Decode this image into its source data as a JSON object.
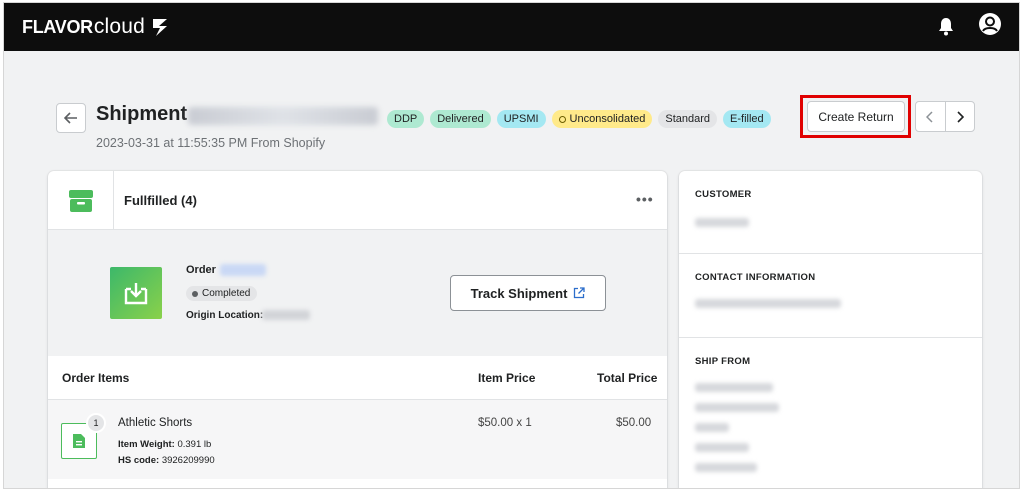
{
  "brand": {
    "bold": "FLAVOR",
    "light": "cloud"
  },
  "header": {
    "title": "Shipment",
    "subtitle": "2023-03-31 at 11:55:35 PM From Shopify",
    "badges": [
      {
        "label": "DDP",
        "color": "#aee9d1"
      },
      {
        "label": "Delivered",
        "color": "#aee9d1"
      },
      {
        "label": "UPSMI",
        "color": "#a4e8f2"
      },
      {
        "label": "Unconsolidated",
        "color": "#ffea8a"
      },
      {
        "label": "Standard",
        "color": "#e4e5e7"
      },
      {
        "label": "E-filled",
        "color": "#a4e8f2"
      }
    ],
    "create_return_label": "Create Return"
  },
  "fulfillment": {
    "title": "Fullfilled (4)",
    "more": "•••",
    "order_label": "Order",
    "status": "Completed",
    "origin_label": "Origin Location:",
    "track_label": "Track Shipment"
  },
  "table": {
    "columns": [
      "Order Items",
      "Item Price",
      "Total Price"
    ],
    "rows": [
      {
        "qty": "1",
        "name": "Athletic Shorts",
        "weight_label": "Item Weight:",
        "weight": "0.391 lb",
        "hs_label": "HS code:",
        "hs": "3926209990",
        "price": "$50.00 x 1",
        "total": "$50.00"
      }
    ]
  },
  "sidebar": {
    "customer_title": "CUSTOMER",
    "contact_title": "CONTACT INFORMATION",
    "ship_from_title": "SHIP FROM"
  },
  "icons": [
    "back-arrow-icon",
    "bell-icon",
    "user-icon",
    "chevron-left-icon",
    "chevron-right-icon",
    "box-icon",
    "download-box-icon",
    "external-link-icon",
    "document-icon"
  ],
  "colors": {
    "highlight": "#e00000",
    "brand_green": "#4cbc5c"
  }
}
